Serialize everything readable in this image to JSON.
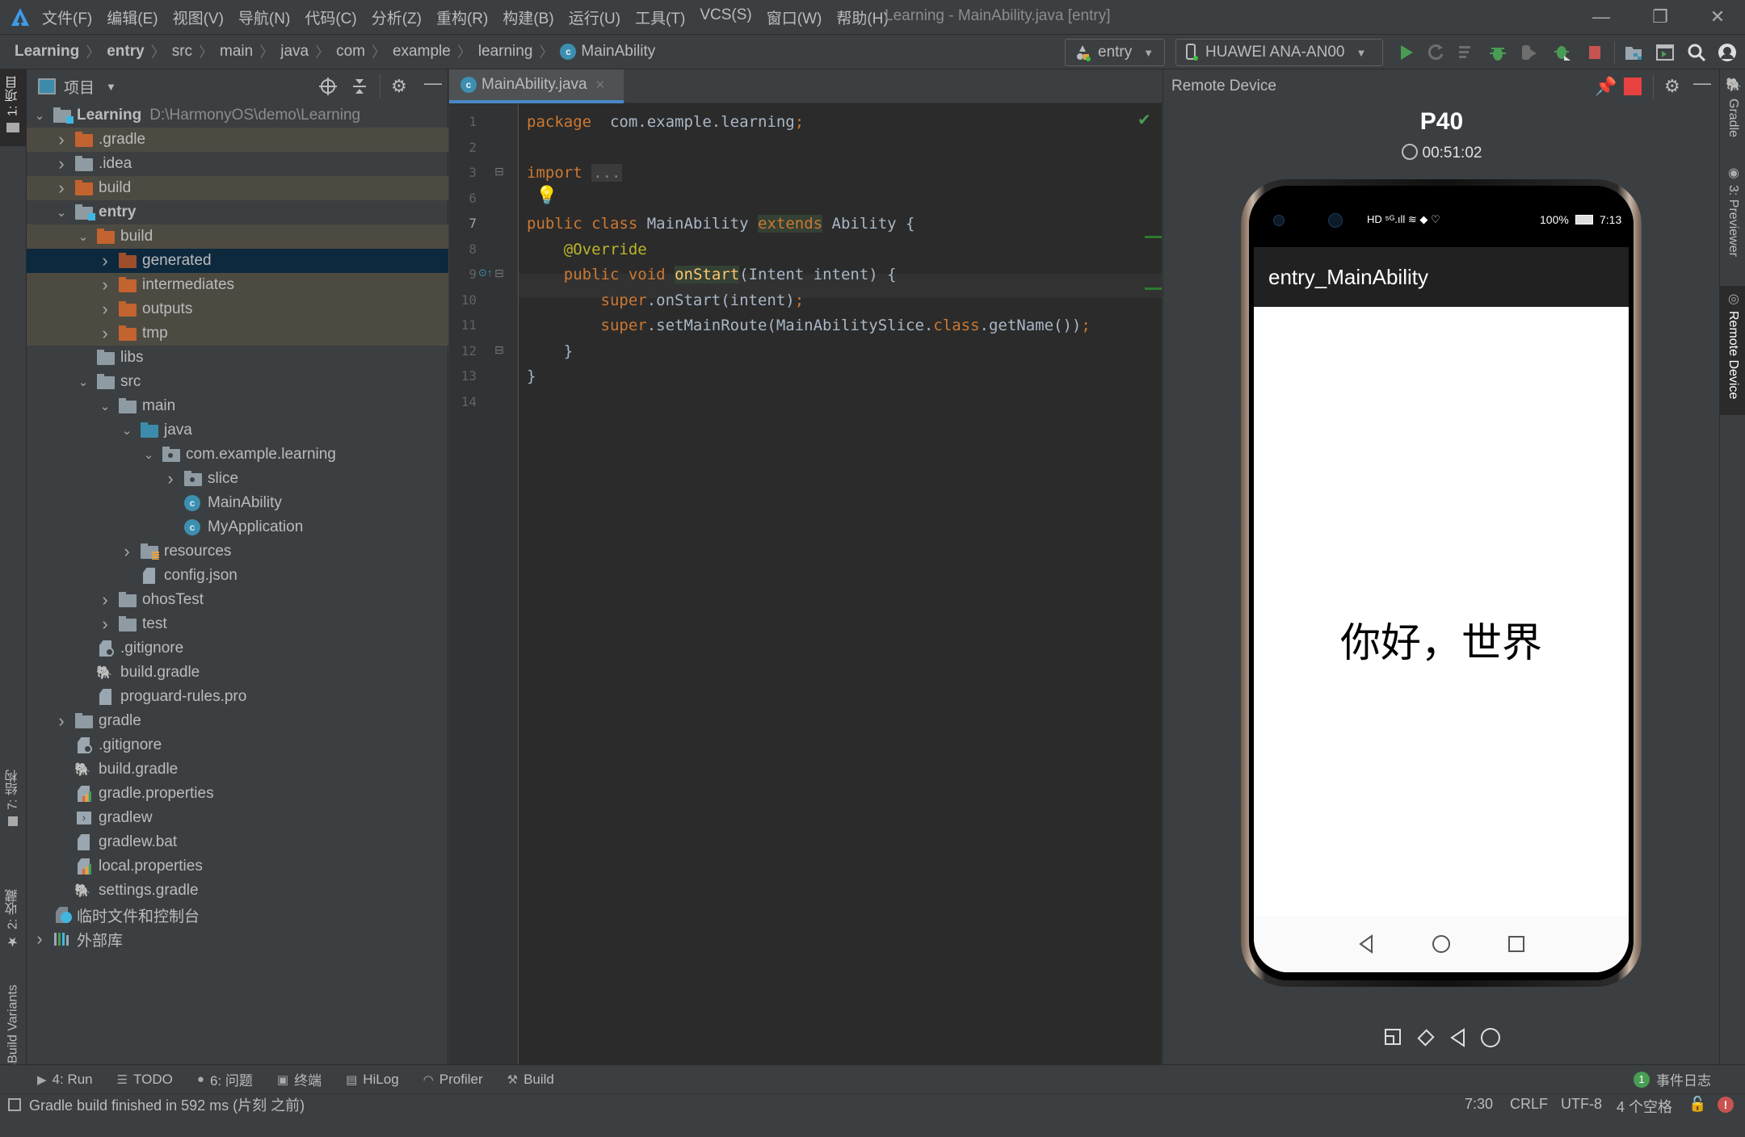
{
  "window": {
    "title": "Learning - MainAbility.java [entry]",
    "menu": [
      "文件(F)",
      "编辑(E)",
      "视图(V)",
      "导航(N)",
      "代码(C)",
      "分析(Z)",
      "重构(R)",
      "构建(B)",
      "运行(U)",
      "工具(T)",
      "VCS(S)",
      "窗口(W)",
      "帮助(H)"
    ],
    "controls": {
      "minimize": "—",
      "restore": "❐",
      "close": "✕"
    }
  },
  "breadcrumb": [
    "Learning",
    "entry",
    "src",
    "main",
    "java",
    "com",
    "example",
    "learning",
    "MainAbility"
  ],
  "toolbar": {
    "config": "entry",
    "device": "HUAWEI ANA-AN00",
    "icons": [
      "run-icon",
      "apply-changes-icon",
      "apply-code-changes-icon",
      "debug-icon",
      "attach-debugger-icon",
      "attach-debug-process-icon",
      "stop-icon",
      "project-structure-icon",
      "terminal-icon",
      "search-icon",
      "account-icon"
    ]
  },
  "left_strip": {
    "project_tab": "1: 项目",
    "structure_tab": "7: 结构",
    "favorites_tab": "2: 收藏",
    "build_variants_tab": "OhosBuild Variants"
  },
  "project_panel": {
    "title": "项目",
    "root_path": "D:\\HarmonyOS\\demo\\Learning",
    "tree": [
      {
        "label": "Learning",
        "depth": 0,
        "arrow": "down",
        "icon": "module",
        "bold": true
      },
      {
        "label": ".gradle",
        "depth": 1,
        "arrow": "right",
        "icon": "folder-orange",
        "excluded": true
      },
      {
        "label": ".idea",
        "depth": 1,
        "arrow": "right",
        "icon": "folder"
      },
      {
        "label": "build",
        "depth": 1,
        "arrow": "right",
        "icon": "folder-orange",
        "excluded": true
      },
      {
        "label": "entry",
        "depth": 1,
        "arrow": "down",
        "icon": "module",
        "bold": true
      },
      {
        "label": "build",
        "depth": 2,
        "arrow": "down",
        "icon": "folder-orange",
        "excluded": true
      },
      {
        "label": "generated",
        "depth": 3,
        "arrow": "right",
        "icon": "folder-orange",
        "selected": true
      },
      {
        "label": "intermediates",
        "depth": 3,
        "arrow": "right",
        "icon": "folder-orange",
        "excluded": true
      },
      {
        "label": "outputs",
        "depth": 3,
        "arrow": "right",
        "icon": "folder-orange",
        "excluded": true
      },
      {
        "label": "tmp",
        "depth": 3,
        "arrow": "right",
        "icon": "folder-orange",
        "excluded": true
      },
      {
        "label": "libs",
        "depth": 2,
        "arrow": "",
        "icon": "folder"
      },
      {
        "label": "src",
        "depth": 2,
        "arrow": "down",
        "icon": "folder"
      },
      {
        "label": "main",
        "depth": 3,
        "arrow": "down",
        "icon": "folder"
      },
      {
        "label": "java",
        "depth": 4,
        "arrow": "down",
        "icon": "folder-blue"
      },
      {
        "label": "com.example.learning",
        "depth": 5,
        "arrow": "down",
        "icon": "package"
      },
      {
        "label": "slice",
        "depth": 6,
        "arrow": "right",
        "icon": "package"
      },
      {
        "label": "MainAbility",
        "depth": 6,
        "arrow": "",
        "icon": "class"
      },
      {
        "label": "MyApplication",
        "depth": 6,
        "arrow": "",
        "icon": "class"
      },
      {
        "label": "resources",
        "depth": 4,
        "arrow": "right",
        "icon": "resources"
      },
      {
        "label": "config.json",
        "depth": 4,
        "arrow": "",
        "icon": "json"
      },
      {
        "label": "ohosTest",
        "depth": 3,
        "arrow": "right",
        "icon": "folder"
      },
      {
        "label": "test",
        "depth": 3,
        "arrow": "right",
        "icon": "folder"
      },
      {
        "label": ".gitignore",
        "depth": 2,
        "arrow": "",
        "icon": "gitignore"
      },
      {
        "label": "build.gradle",
        "depth": 2,
        "arrow": "",
        "icon": "gradle"
      },
      {
        "label": "proguard-rules.pro",
        "depth": 2,
        "arrow": "",
        "icon": "text"
      },
      {
        "label": "gradle",
        "depth": 1,
        "arrow": "right",
        "icon": "folder"
      },
      {
        "label": ".gitignore",
        "depth": 1,
        "arrow": "",
        "icon": "gitignore"
      },
      {
        "label": "build.gradle",
        "depth": 1,
        "arrow": "",
        "icon": "gradle"
      },
      {
        "label": "gradle.properties",
        "depth": 1,
        "arrow": "",
        "icon": "properties"
      },
      {
        "label": "gradlew",
        "depth": 1,
        "arrow": "",
        "icon": "shell"
      },
      {
        "label": "gradlew.bat",
        "depth": 1,
        "arrow": "",
        "icon": "text"
      },
      {
        "label": "local.properties",
        "depth": 1,
        "arrow": "",
        "icon": "properties"
      },
      {
        "label": "settings.gradle",
        "depth": 1,
        "arrow": "",
        "icon": "gradle"
      },
      {
        "label": "临时文件和控制台",
        "depth": 0,
        "arrow": "",
        "icon": "scratches"
      },
      {
        "label": "外部库",
        "depth": 0,
        "arrow": "right",
        "icon": "libraries"
      }
    ]
  },
  "editor": {
    "tab": "MainAbility.java",
    "current_line": 7,
    "lines": [
      {
        "n": "1",
        "tokens": [
          [
            "kw",
            "package"
          ],
          [
            "",
            "  com.example.learning"
          ],
          [
            "kw",
            ";"
          ]
        ]
      },
      {
        "n": "2",
        "tokens": []
      },
      {
        "n": "3",
        "tokens": [
          [
            "kw",
            "import"
          ],
          [
            "",
            " "
          ],
          [
            "dots",
            "..."
          ]
        ]
      },
      {
        "n": "6",
        "tokens": []
      },
      {
        "n": "7",
        "tokens": [
          [
            "kw",
            "public class"
          ],
          [
            "",
            " MainAbility "
          ],
          [
            "kwhl",
            "extends"
          ],
          [
            "",
            " Ability {"
          ]
        ]
      },
      {
        "n": "8",
        "tokens": [
          [
            "",
            "    "
          ],
          [
            "ann",
            "@Override"
          ]
        ]
      },
      {
        "n": "9",
        "tokens": [
          [
            "",
            "    "
          ],
          [
            "kw",
            "public void"
          ],
          [
            "",
            " "
          ],
          [
            "fnhl",
            "onStart"
          ],
          [
            "",
            "(Intent intent) {"
          ]
        ]
      },
      {
        "n": "10",
        "tokens": [
          [
            "",
            "        "
          ],
          [
            "kw",
            "super"
          ],
          [
            "",
            ".onStart(intent)"
          ],
          [
            "kw",
            ";"
          ]
        ]
      },
      {
        "n": "11",
        "tokens": [
          [
            "",
            "        "
          ],
          [
            "kw",
            "super"
          ],
          [
            "",
            ".setMainRoute(MainAbilitySlice."
          ],
          [
            "kw",
            "class"
          ],
          [
            "",
            ".getName())"
          ],
          [
            "kw",
            ";"
          ]
        ]
      },
      {
        "n": "12",
        "tokens": [
          [
            "",
            "    }"
          ]
        ]
      },
      {
        "n": "13",
        "tokens": [
          [
            "",
            "}"
          ]
        ]
      },
      {
        "n": "14",
        "tokens": []
      }
    ]
  },
  "remote_device": {
    "title": "Remote Device",
    "device_name": "P40",
    "timer": "00:51:02",
    "phone": {
      "battery": "100%",
      "time": "7:13",
      "app_title": "entry_MainAbility",
      "content_text": "你好，世界"
    }
  },
  "right_strip": {
    "gradle_tab": "Gradle",
    "previewer_tab": "3: Previewer",
    "remote_device_tab": "Remote Device"
  },
  "bottom_tools": [
    {
      "icon": "run-icon",
      "label": "4: Run"
    },
    {
      "icon": "todo-icon",
      "label": "TODO"
    },
    {
      "icon": "problems-icon",
      "label": "6: 问题"
    },
    {
      "icon": "terminal-icon",
      "label": "终端"
    },
    {
      "icon": "hilog-icon",
      "label": "HiLog"
    },
    {
      "icon": "profiler-icon",
      "label": "Profiler"
    },
    {
      "icon": "build-icon",
      "label": "Build"
    }
  ],
  "event_log": {
    "count": "1",
    "label": "事件日志"
  },
  "status": {
    "message": "Gradle build finished in 592 ms (片刻 之前)",
    "position": "7:30",
    "line_sep": "CRLF",
    "encoding": "UTF-8",
    "indent": "4 个空格"
  }
}
